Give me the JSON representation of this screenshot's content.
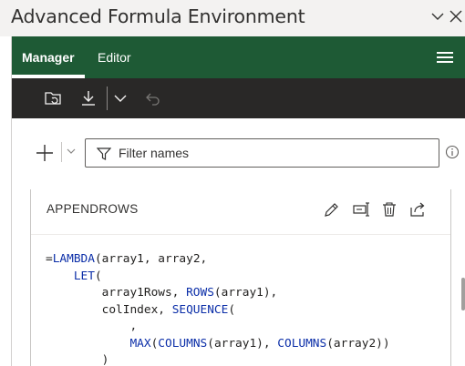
{
  "window": {
    "title": "Advanced Formula Environment"
  },
  "nav": {
    "tabs": [
      {
        "label": "Manager",
        "active": true
      },
      {
        "label": "Editor",
        "active": false
      }
    ]
  },
  "filter": {
    "placeholder": "Filter names"
  },
  "card": {
    "name": "APPENDROWS",
    "code_lines": [
      [
        {
          "t": "=",
          "k": false
        },
        {
          "t": "LAMBDA",
          "k": true
        },
        {
          "t": "(array1, array2,",
          "k": false
        }
      ],
      [
        {
          "t": "    ",
          "k": false
        },
        {
          "t": "LET",
          "k": true
        },
        {
          "t": "(",
          "k": false
        }
      ],
      [
        {
          "t": "        array1Rows, ",
          "k": false
        },
        {
          "t": "ROWS",
          "k": true
        },
        {
          "t": "(array1),",
          "k": false
        }
      ],
      [
        {
          "t": "        colIndex, ",
          "k": false
        },
        {
          "t": "SEQUENCE",
          "k": true
        },
        {
          "t": "(",
          "k": false
        }
      ],
      [
        {
          "t": "            ,",
          "k": false
        }
      ],
      [
        {
          "t": "            ",
          "k": false
        },
        {
          "t": "MAX",
          "k": true
        },
        {
          "t": "(",
          "k": false
        },
        {
          "t": "COLUMNS",
          "k": true
        },
        {
          "t": "(array1), ",
          "k": false
        },
        {
          "t": "COLUMNS",
          "k": true
        },
        {
          "t": "(array2))",
          "k": false
        }
      ],
      [
        {
          "t": "        )",
          "k": false
        }
      ]
    ]
  },
  "colors": {
    "nav_bg": "#1e5a35",
    "toolbar_bg": "#292827",
    "keyword": "#0b2ea8"
  }
}
